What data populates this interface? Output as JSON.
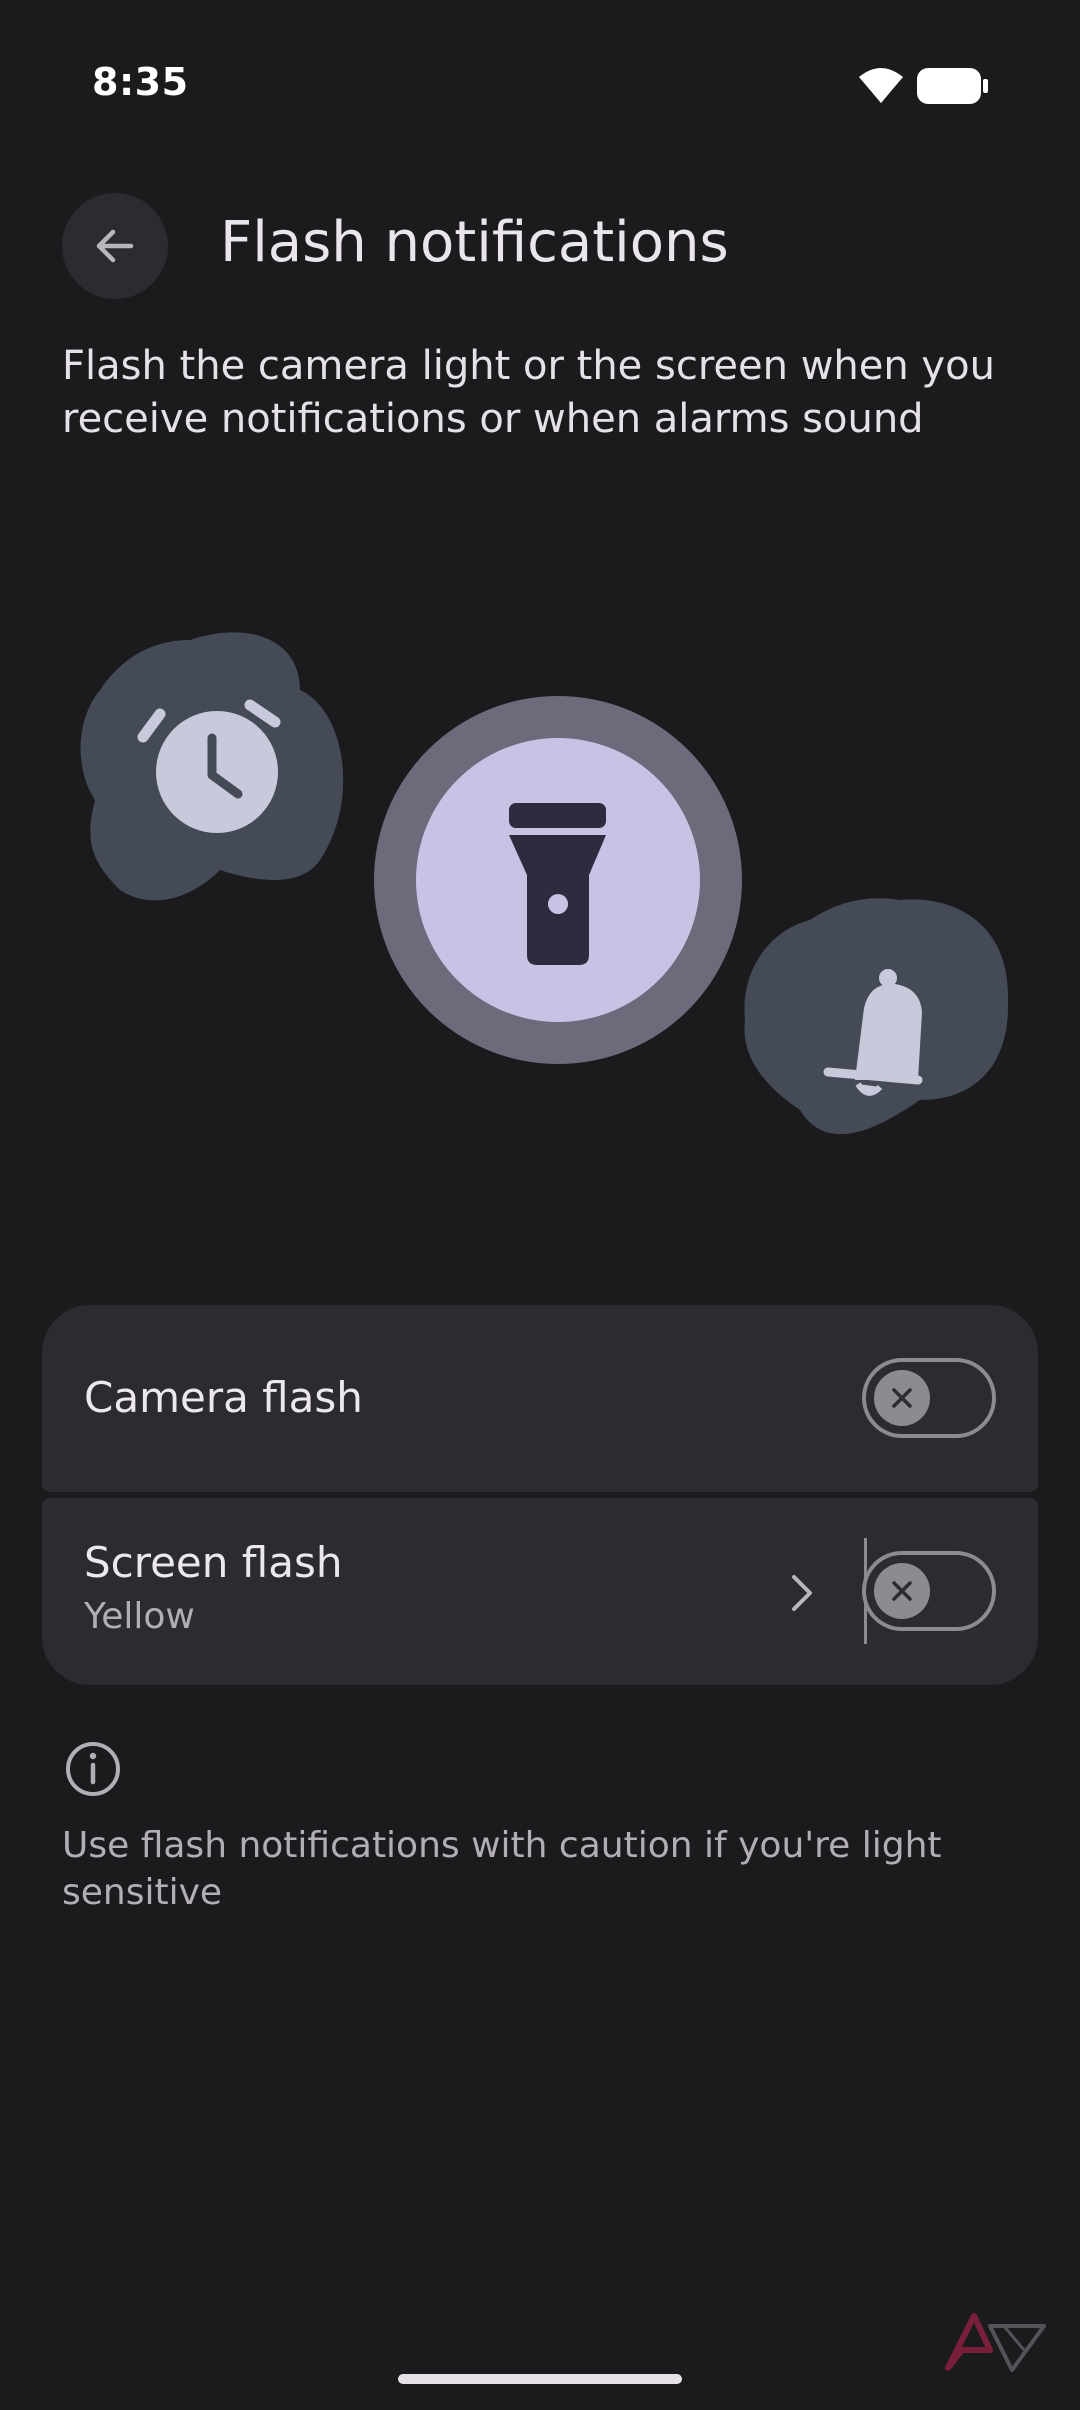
{
  "status_bar": {
    "time": "8:35",
    "wifi_icon": "wifi-icon",
    "battery_icon": "battery-icon"
  },
  "header": {
    "back_icon": "arrow-back-icon",
    "title": "Flash notifications"
  },
  "description": "Flash the camera light or the screen when you receive notifications or when alarms sound",
  "illustration": {
    "icons": [
      "alarm-clock-icon",
      "flashlight-icon",
      "bell-icon"
    ]
  },
  "settings": {
    "camera_flash": {
      "title": "Camera flash",
      "enabled": false
    },
    "screen_flash": {
      "title": "Screen flash",
      "subtitle": "Yellow",
      "enabled": false
    }
  },
  "info": {
    "icon": "info-icon",
    "text": "Use flash notifications with caution if you're light sensitive"
  },
  "colors": {
    "background": "#1b1b1d",
    "card": "#2c2c30",
    "accent": "#c8c2e4",
    "shape": "#444a56"
  }
}
